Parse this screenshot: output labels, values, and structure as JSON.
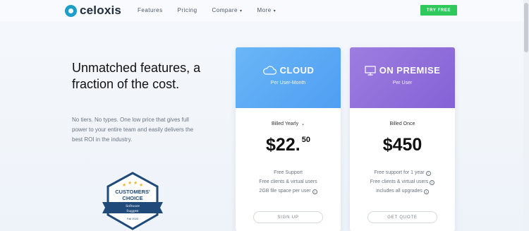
{
  "header": {
    "brand": "celoxis",
    "nav": [
      {
        "label": "Features",
        "has_caret": false
      },
      {
        "label": "Pricing",
        "has_caret": false
      },
      {
        "label": "Compare",
        "has_caret": true
      },
      {
        "label": "More",
        "has_caret": true
      }
    ],
    "try_button": "TRY FREE"
  },
  "hero": {
    "headline_line1": "Unmatched features, a",
    "headline_line2": "fraction of the cost.",
    "subtext": "No tiers. No types. One low price that gives full power to your entire team and easily delivers the best ROI in the industry."
  },
  "badge": {
    "line1": "CUSTOMERS'",
    "line2": "CHOICE",
    "ribbon_line1": "Software",
    "ribbon_line2": "Suggest",
    "year": "Fall 2020"
  },
  "plans": [
    {
      "title": "CLOUD",
      "icon": "cloud-icon",
      "subtitle": "Per User-Month",
      "billing": "Billed Yearly",
      "price_main": "$22.",
      "price_cents": "50",
      "features": [
        "Free Support",
        "Free clients & virtual users",
        "2GB file space per user"
      ],
      "button": "SIGN UP"
    },
    {
      "title": "ON PREMISE",
      "icon": "monitor-icon",
      "subtitle": "Per User",
      "billing": "Billed Once",
      "price_main": "$450",
      "price_cents": "",
      "features": [
        "Free support for 1 year",
        "Free clients & virtual users",
        "includes all upgrades"
      ],
      "button": "GET QUOTE"
    }
  ],
  "colors": {
    "cloud_accent": "#5aa8f5",
    "premise_accent": "#9170da",
    "try_button": "#2ec85b",
    "brand": "#1c9ec9"
  }
}
